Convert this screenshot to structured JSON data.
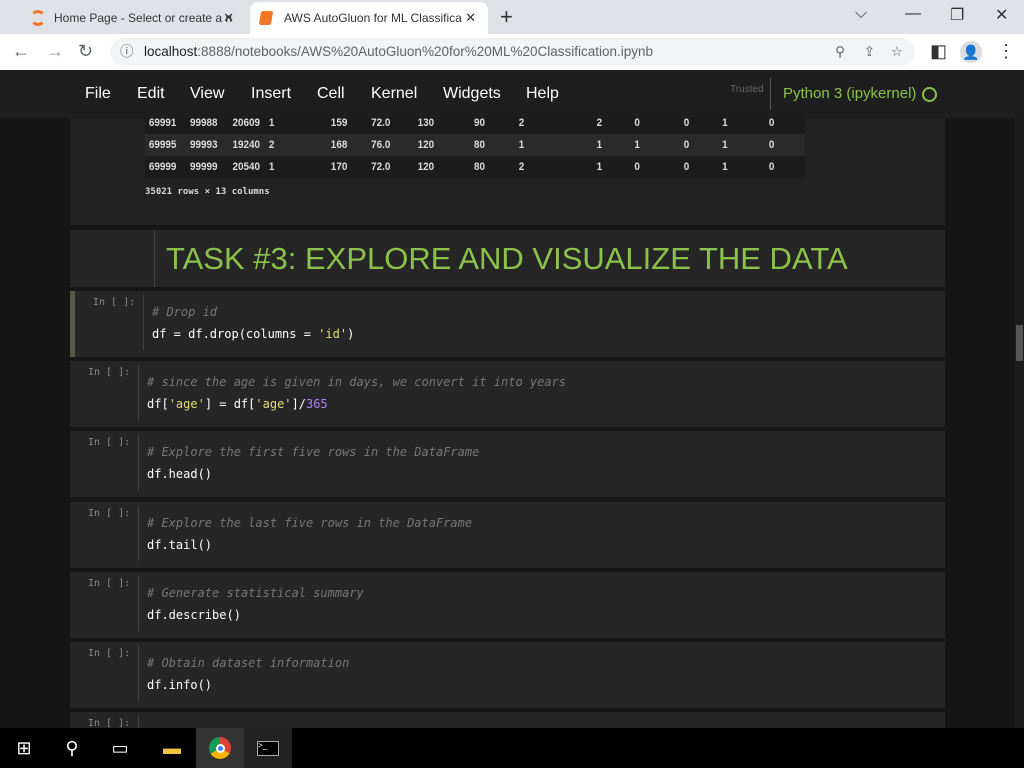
{
  "browser": {
    "tabs": [
      {
        "title": "Home Page - Select or create a n"
      },
      {
        "title": "AWS AutoGluon for ML Classifica"
      }
    ],
    "url_host": "localhost",
    "url_path": ":8888/notebooks/AWS%20AutoGluon%20for%20ML%20Classification.ipynb"
  },
  "menu": [
    "File",
    "Edit",
    "View",
    "Insert",
    "Cell",
    "Kernel",
    "Widgets",
    "Help"
  ],
  "trusted": "Trusted",
  "kernel": "Python 3 (ipykernel)",
  "output": {
    "rows": [
      [
        "69991",
        "99988",
        "20609",
        "1",
        "159",
        "72.0",
        "130",
        "90",
        "2",
        "2",
        "0",
        "0",
        "1",
        "0"
      ],
      [
        "69995",
        "99993",
        "19240",
        "2",
        "168",
        "76.0",
        "120",
        "80",
        "1",
        "1",
        "1",
        "0",
        "1",
        "0"
      ],
      [
        "69999",
        "99999",
        "20540",
        "1",
        "170",
        "72.0",
        "120",
        "80",
        "2",
        "1",
        "0",
        "0",
        "1",
        "0"
      ]
    ],
    "summary": "35021 rows × 13 columns"
  },
  "heading": "TASK #3: EXPLORE AND VISUALIZE THE DATA",
  "prompt": "In [ ]:",
  "cells": [
    {
      "comment": "# Drop id",
      "code_a": "df = df.drop(columns = ",
      "code_s": "'id'",
      "code_b": ")"
    },
    {
      "comment": "# since the age is given in days, we convert it into years"
    },
    {
      "comment": "# Explore the first five rows in the DataFrame",
      "code": "df.head()"
    },
    {
      "comment": "# Explore the last five rows in the DataFrame",
      "code": "df.tail()"
    },
    {
      "comment": "# Generate statistical summary",
      "code": "df.describe()"
    },
    {
      "comment": "# Obtain dataset information",
      "code": "df.info()"
    }
  ],
  "age_code": {
    "a": "df[",
    "s1": "'age'",
    "b": "] = df[",
    "s2": "'age'",
    "c": "]/",
    "n": "365"
  }
}
